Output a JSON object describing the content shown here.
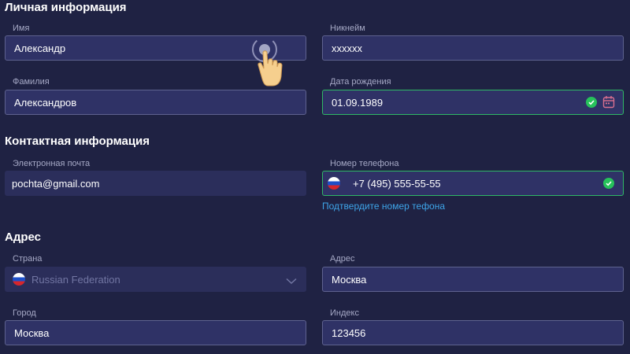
{
  "sections": {
    "personal": "Личная информация",
    "contact": "Контактная информация",
    "address": "Адрес"
  },
  "fields": {
    "first_name": {
      "label": "Имя",
      "value": "Александр"
    },
    "nickname": {
      "label": "Никнейм",
      "value": "xxxxxx"
    },
    "last_name": {
      "label": "Фамилия",
      "value": "Александров"
    },
    "birth_date": {
      "label": "Дата рождения",
      "value": "01.09.1989"
    },
    "email": {
      "label": "Электронная почта",
      "value": "pochta@gmail.com"
    },
    "phone": {
      "label": "Номер телефона",
      "value": "+7 (495) 555-55-55"
    },
    "country": {
      "label": "Страна",
      "value": "Russian Federation"
    },
    "street": {
      "label": "Адрес",
      "value": "Москва"
    },
    "city": {
      "label": "Город",
      "value": "Москва"
    },
    "zip": {
      "label": "Индекс",
      "value": "123456"
    }
  },
  "phone_confirm_link": "Подтвердите номер тефона",
  "icons": {
    "valid": "check-circle-icon",
    "calendar": "calendar-icon",
    "flag": "russia-flag-icon",
    "dropdown": "chevron-down-icon",
    "pointer": "hand-pointer-icon"
  },
  "colors": {
    "background": "#1f2243",
    "field_bg": "#2f3266",
    "field_border": "#5e628f",
    "valid_border": "#2fb865",
    "link": "#3ea5e9"
  }
}
